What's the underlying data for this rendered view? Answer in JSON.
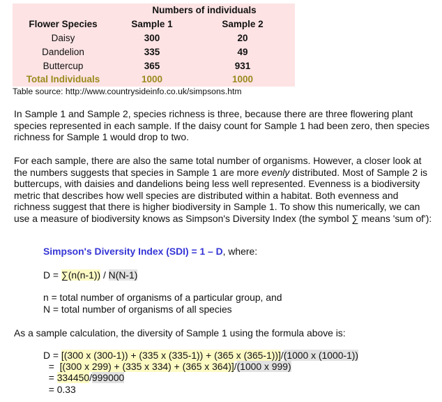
{
  "table": {
    "group_header": "Numbers of individuals",
    "headers": [
      "Flower Species",
      "Sample 1",
      "Sample 2"
    ],
    "rows": [
      [
        "Daisy",
        "300",
        "20"
      ],
      [
        "Dandelion",
        "335",
        "49"
      ],
      [
        "Buttercup",
        "365",
        "931"
      ]
    ],
    "total": [
      "Total Individuals",
      "1000",
      "1000"
    ],
    "source": "Table source: http://www.countrysideinfo.co.uk/simpsons.htm"
  },
  "paragraphs": {
    "p1": "In Sample 1 and Sample 2, species richness is three, because there are three flowering plant species represented in each sample. If the daisy count for Sample 1 had been zero, then species richness for Sample 1 would drop to two.",
    "p2_a": "For each sample, there are also the same total number of organisms. However, a closer look at the numbers suggests that species in Sample 1 are more ",
    "p2_em": "evenly",
    "p2_b": " distributed. Most of Sample 2 is buttercups, with daisies and dandelions being less well represented. Evenness is a biodiversity metric that describes how well species are distributed within a habitat. Both evenness and richness suggest that there is higher biodiversity in Sample 1. To show this numerically, we can use a measure of biodiversity knows as Simpson's Diversity Index (the symbol ∑ means 'sum of'):",
    "p3": "As a sample calculation, the diversity of Sample 1 using the formula above is:"
  },
  "formula": {
    "sdi_label": "Simpson's Diversity Index (SDI) = 1 – D",
    "sdi_suffix": ", where:",
    "d_prefix": "D = ",
    "d_numerator": "∑(n(n-1))",
    "d_slash": " / ",
    "d_denominator": "N(N-1)",
    "n_def": "n = total number of organisms of a particular group, and",
    "N_def": "N = total number of organisms of all species"
  },
  "calculation": {
    "line1_prefix": "D = ",
    "line1_num": "[(300 x (300-1)) + (335 x (335-1)) + (365 x (365-1))]",
    "line1_den": "(1000 x (1000-1))",
    "line2_prefix": "  =  ",
    "line2_num": "[(300 x 299) + (335 x 334) + (365 x 364)]",
    "line2_den": "(1000 x 999)",
    "line3_prefix": "  = ",
    "line3_num": "334450",
    "line3_den": "999000",
    "line4": "  = 0.33",
    "slash": "/"
  }
}
